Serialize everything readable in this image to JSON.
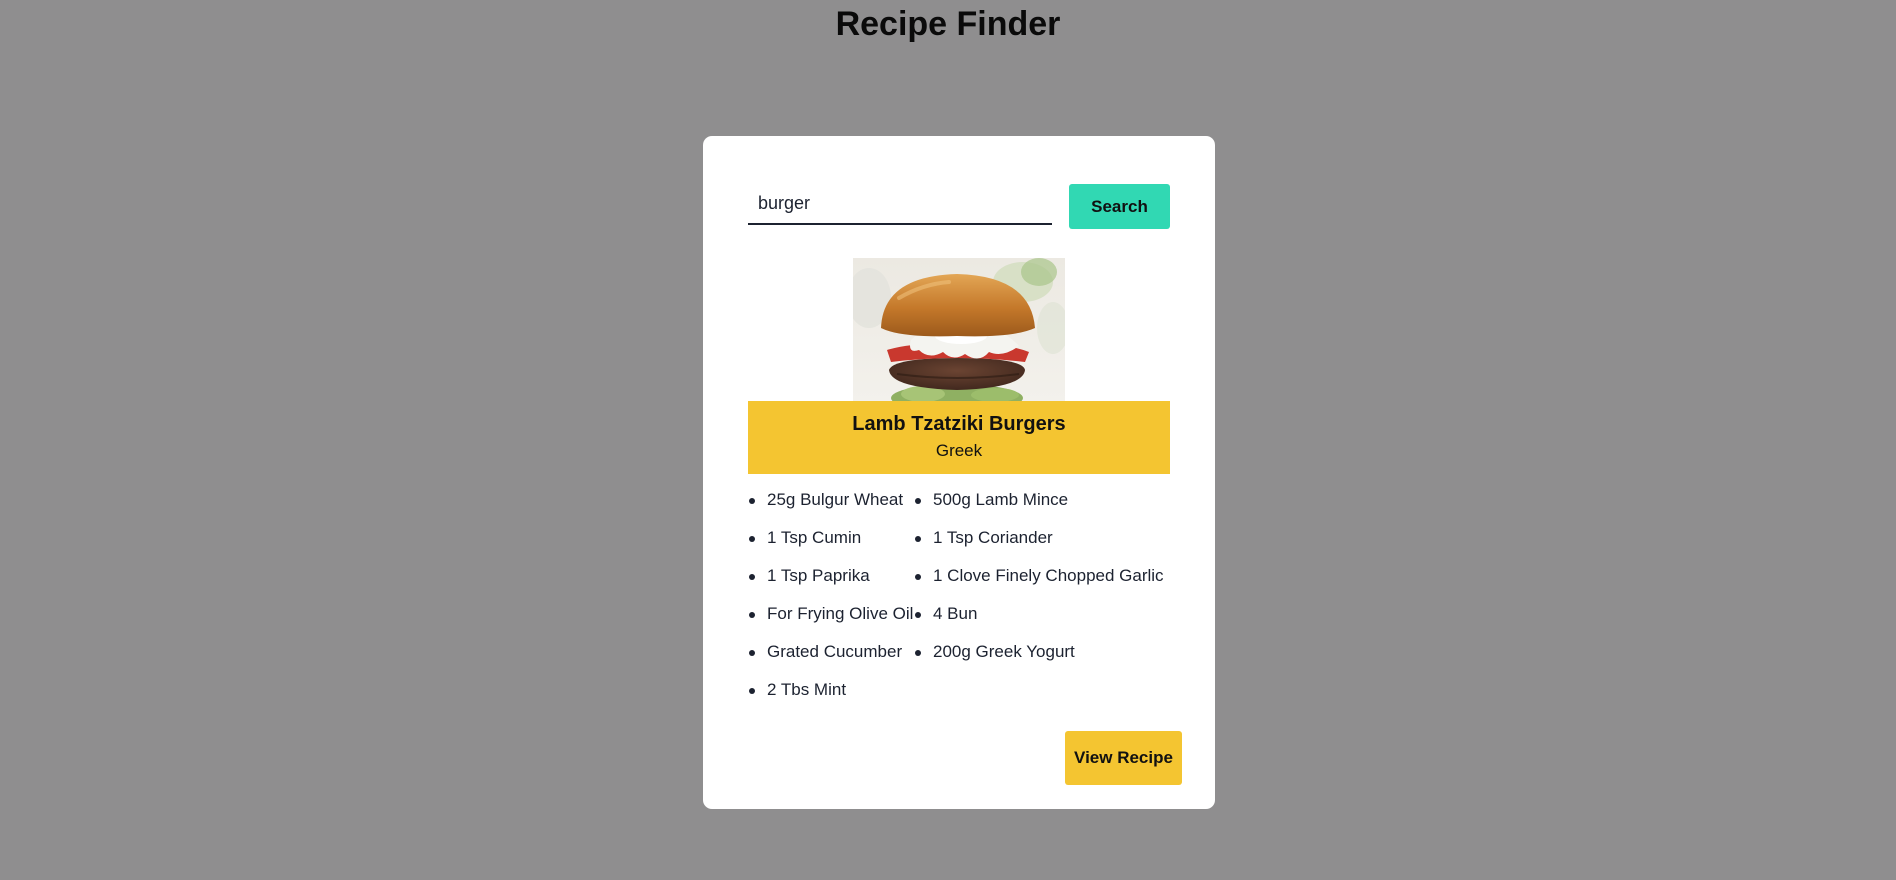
{
  "page": {
    "title": "Recipe Finder"
  },
  "search": {
    "value": "burger",
    "button_label": "Search"
  },
  "meal": {
    "name": "Lamb Tzatziki Burgers",
    "area": "Greek",
    "image": "burger-photo"
  },
  "ingredients": [
    "25g Bulgur Wheat",
    "500g Lamb Mince",
    "1 Tsp Cumin",
    "1 Tsp Coriander",
    "1 Tsp Paprika",
    "1 Clove Finely Chopped Garlic",
    "For Frying Olive Oil",
    "4 Bun",
    "Grated Cucumber",
    "200g Greek Yogurt",
    "2 Tbs Mint"
  ],
  "actions": {
    "view_recipe_label": "View Recipe"
  },
  "colors": {
    "background": "#8f8e8f",
    "card": "#ffffff",
    "search_button": "#31d8b3",
    "accent_yellow": "#f4c531",
    "text_dark": "#1c2230"
  }
}
